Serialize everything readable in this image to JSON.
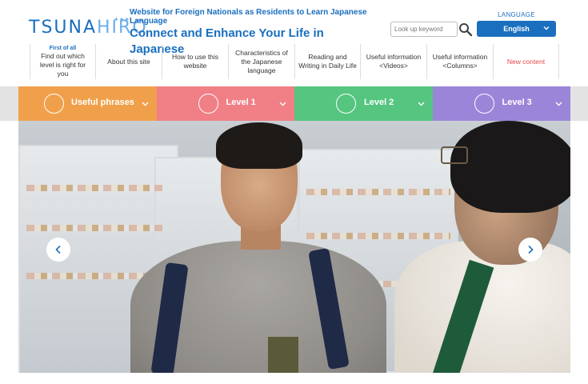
{
  "header": {
    "logo_main": "TSUNA",
    "logo_accent": "HIRO",
    "tagline_small": "Website for Foreign Nationals as Residents to Learn Japanese Language",
    "tagline_big": "Connect and Enhance Your Life in Japanese",
    "search_placeholder": "Look up keyword",
    "language_label": "LANGUAGE",
    "language_value": "English"
  },
  "nav": {
    "items": [
      {
        "kicker": "First of all",
        "label": "Find out which level is right for you"
      },
      {
        "label": "About this site"
      },
      {
        "label": "How to use this website"
      },
      {
        "label": "Characteristics of the Japanese language"
      },
      {
        "label": "Reading and Writing in Daily Life"
      },
      {
        "label": "Useful information <Videos>"
      },
      {
        "label": "Useful information <Columns>"
      },
      {
        "label": "New content"
      }
    ]
  },
  "levels": {
    "tabs": [
      {
        "label": "Useful phrases",
        "color": "#f0a04b"
      },
      {
        "label": "Level 1",
        "color": "#f07f86"
      },
      {
        "label": "Level 2",
        "color": "#55c580"
      },
      {
        "label": "Level 3",
        "color": "#9b85d8"
      }
    ]
  },
  "colors": {
    "brand": "#1a6fbf",
    "new": "#e8474d"
  },
  "icons": {
    "search": "search-icon",
    "chevron": "chevron-down-icon",
    "prev": "chevron-left-icon",
    "next": "chevron-right-icon"
  }
}
